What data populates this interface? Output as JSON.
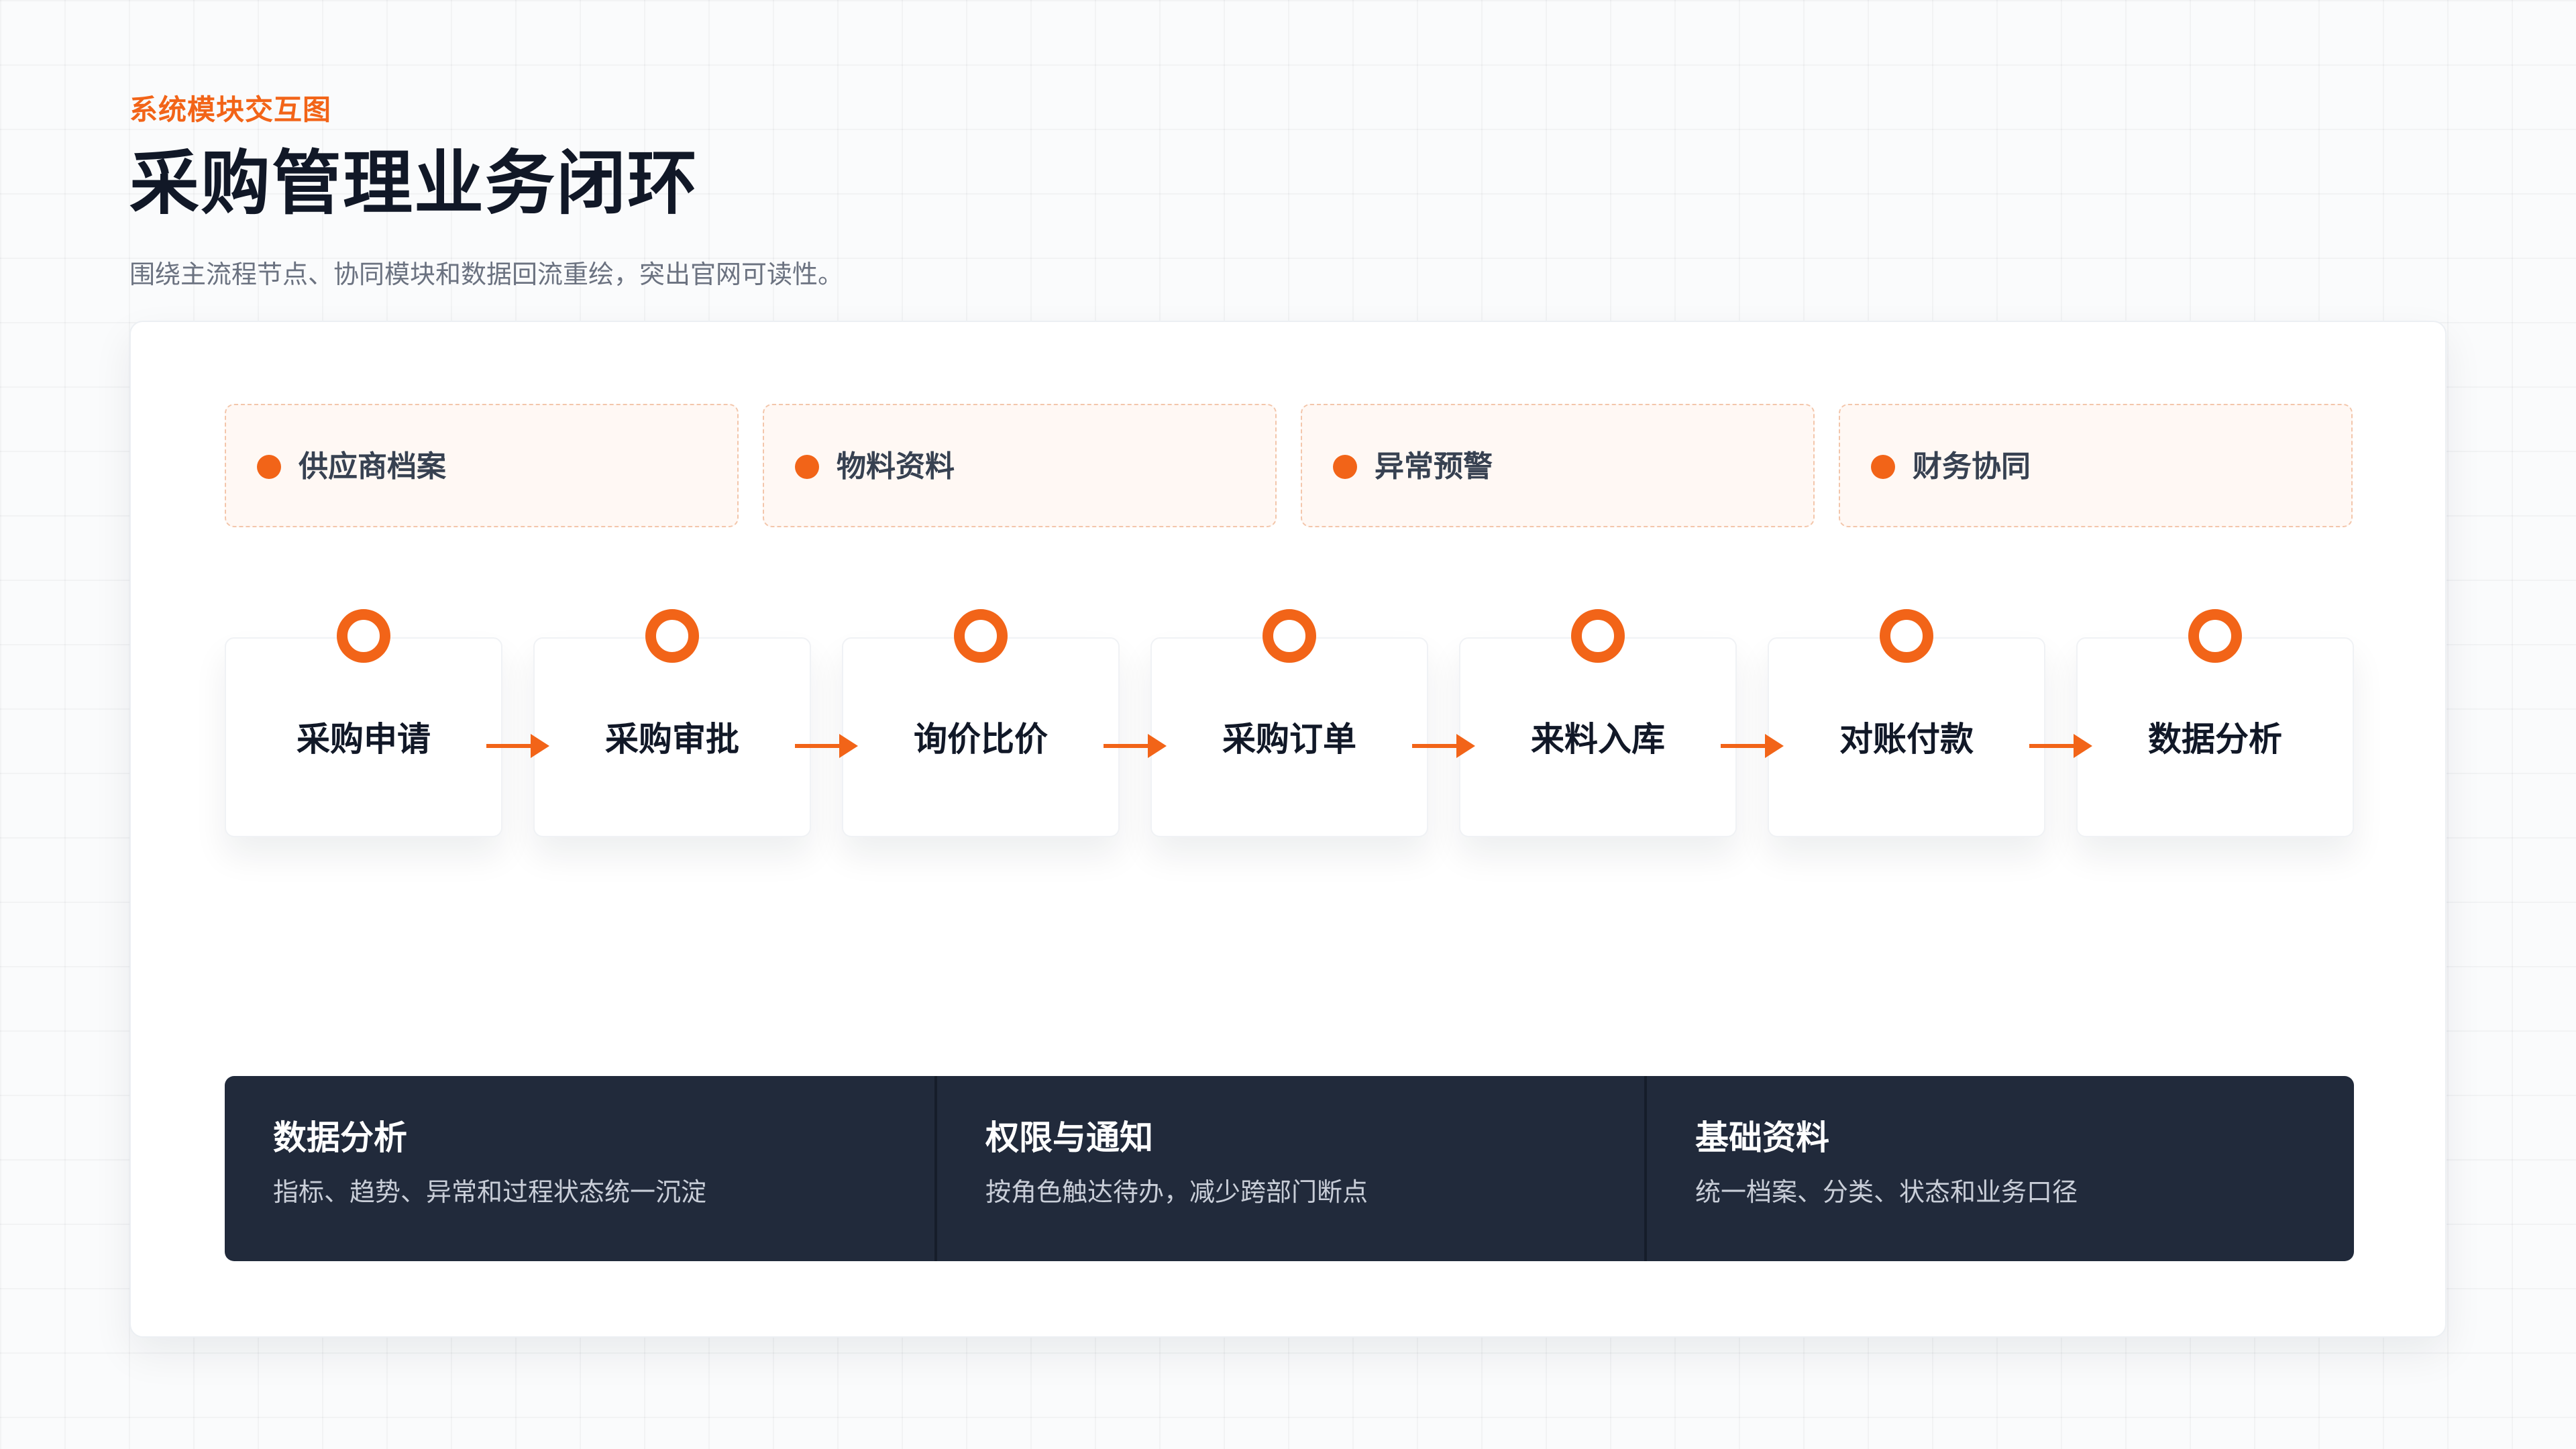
{
  "header": {
    "eyebrow": "系统模块交互图",
    "title": "采购管理业务闭环",
    "subtitle": "围绕主流程节点、协同模块和数据回流重绘，突出官网可读性。"
  },
  "modules": [
    {
      "label": "供应商档案"
    },
    {
      "label": "物料资料"
    },
    {
      "label": "异常预警"
    },
    {
      "label": "财务协同"
    }
  ],
  "flow": {
    "steps": [
      {
        "label": "采购申请"
      },
      {
        "label": "采购审批"
      },
      {
        "label": "询价比价"
      },
      {
        "label": "采购订单"
      },
      {
        "label": "来料入库"
      },
      {
        "label": "对账付款"
      },
      {
        "label": "数据分析"
      }
    ]
  },
  "panels": [
    {
      "title": "数据分析",
      "description": "指标、趋势、异常和过程状态统一沉淀"
    },
    {
      "title": "权限与通知",
      "description": "按角色触达待办，减少跨部门断点"
    },
    {
      "title": "基础资料",
      "description": "统一档案、分类、状态和业务口径"
    }
  ],
  "colors": {
    "accent": "#f26418",
    "title": "#111827",
    "dark_panel": "#212a3b"
  }
}
